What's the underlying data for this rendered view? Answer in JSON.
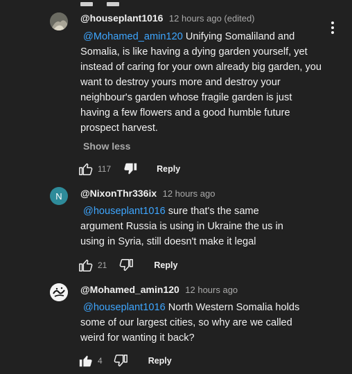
{
  "comments": [
    {
      "author": "@houseplant1016",
      "time": "12 hours ago (edited)",
      "mention": "@Mohamed_amin120",
      "text": "Unifying Somaliland and Somalia, is like having a dying garden yourself, yet instead of caring for your own already big garden, you want to destroy yours more and destroy your neighbour's garden whose fragile garden is just having a few flowers and a good humble future prospect harvest.",
      "show_less": "Show less",
      "likes": "117",
      "reply": "Reply"
    },
    {
      "author": "@NixonThr336ix",
      "avatar_letter": "N",
      "time": "12 hours ago",
      "mention": "@houseplant1016",
      "text": " sure that's the same argument Russia is using in Ukraine the us in using in Syria, still doesn't make it legal",
      "likes": "21",
      "reply": "Reply"
    },
    {
      "author": "@Mohamed_amin120",
      "time": "12 hours ago",
      "mention": "@houseplant1016",
      "text": "North Western Somalia holds some of our largest cities, so why are we called weird for wanting it back?",
      "likes": "4",
      "reply": "Reply"
    }
  ],
  "colors": {
    "background": "#212121",
    "mention": "#3ea6ff",
    "secondary_text": "#aaaaaa",
    "avatar_n": "#2e8b9a"
  }
}
